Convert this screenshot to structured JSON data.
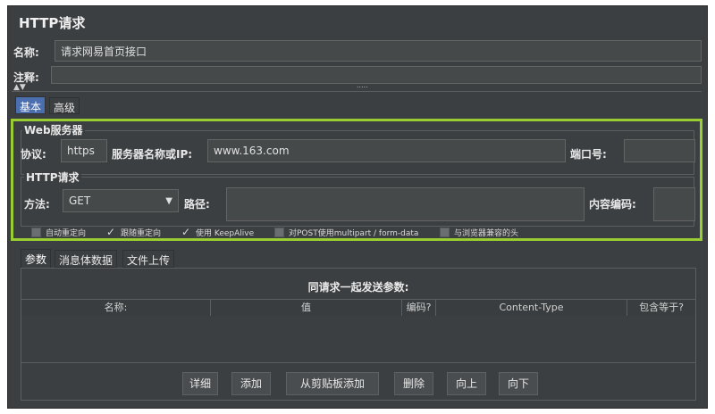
{
  "colors": {
    "background": "#3c3f41",
    "accent_tab": "#4b6eaf",
    "highlight_border": "#9acd32"
  },
  "title": "HTTP请求",
  "name": {
    "label": "名称:",
    "value": "请求网易首页接口"
  },
  "comment": {
    "label": "注释:",
    "value": ""
  },
  "divider_grip": ".....",
  "main_tabs": [
    {
      "label": "基本",
      "active": true
    },
    {
      "label": "高级",
      "active": false
    }
  ],
  "web_server": {
    "title": "Web服务器",
    "protocol_label": "协议:",
    "protocol_value": "https",
    "server_label": "服务器名称或IP:",
    "server_value": "www.163.com",
    "port_label": "端口号:",
    "port_value": ""
  },
  "http_request": {
    "title": "HTTP请求",
    "method_label": "方法:",
    "method_value": "GET",
    "dropdown_glyph": "▼",
    "path_label": "路径:",
    "path_value": "",
    "encoding_label": "内容编码:",
    "encoding_value": ""
  },
  "options": [
    {
      "label": "自动重定向",
      "checked": false
    },
    {
      "label": "跟随重定向",
      "checked": true
    },
    {
      "label": "使用 KeepAlive",
      "checked": true
    },
    {
      "label": "对POST使用multipart / form-data",
      "checked": false
    },
    {
      "label": "与浏览器兼容的头",
      "checked": false
    }
  ],
  "param_tabs": [
    {
      "label": "参数",
      "active": true
    },
    {
      "label": "消息体数据",
      "active": false
    },
    {
      "label": "文件上传",
      "active": false
    }
  ],
  "params": {
    "heading": "同请求一起发送参数:",
    "columns": [
      "名称:",
      "值",
      "编码?",
      "Content-Type",
      "包含等于?"
    ],
    "rows": []
  },
  "buttons": {
    "detail": "详细",
    "add": "添加",
    "add_clipboard": "从剪贴板添加",
    "delete": "删除",
    "up": "向上",
    "down": "向下"
  }
}
